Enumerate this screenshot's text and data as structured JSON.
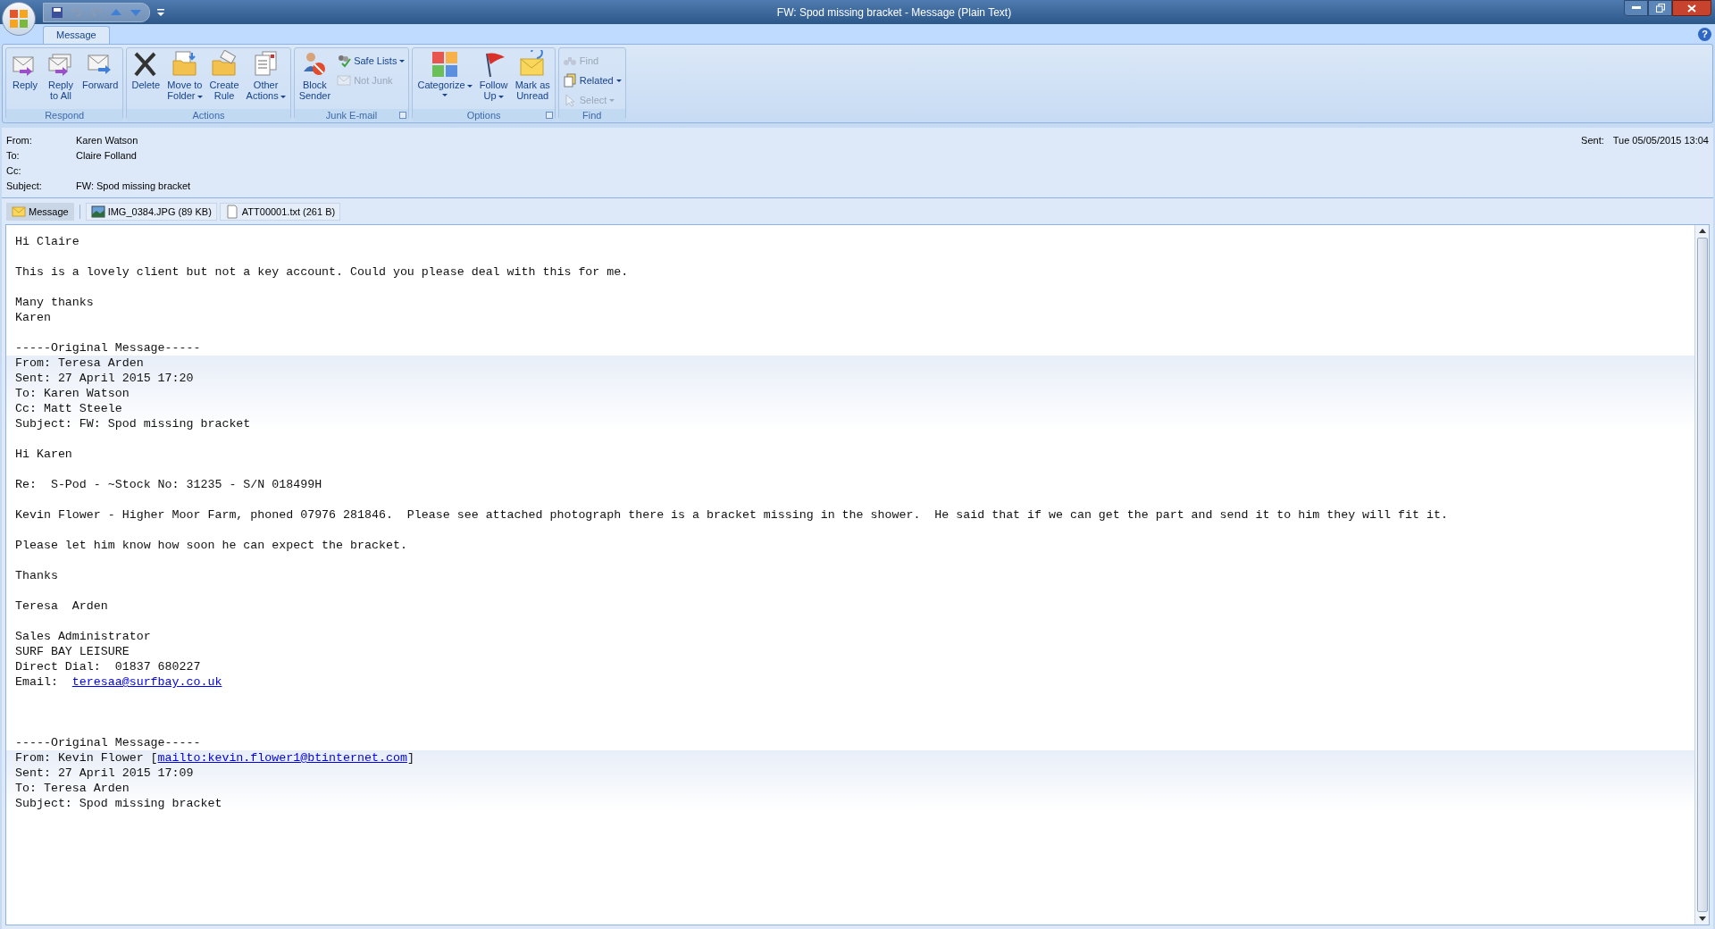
{
  "window": {
    "title": "FW: Spod missing bracket  - Message (Plain Text)"
  },
  "tabs": [
    {
      "label": "Message",
      "selected": true
    }
  ],
  "help_button": "?",
  "ribbon": [
    {
      "label": "Respond",
      "launcher": false,
      "buttons": [
        {
          "lines": [
            "Reply"
          ],
          "kind": "large",
          "dropdown": false,
          "disabled": false
        },
        {
          "lines": [
            "Reply",
            "to All"
          ],
          "kind": "large",
          "dropdown": false,
          "disabled": false
        },
        {
          "lines": [
            "Forward"
          ],
          "kind": "large",
          "dropdown": false,
          "disabled": false
        }
      ]
    },
    {
      "label": "Actions",
      "launcher": false,
      "buttons": [
        {
          "lines": [
            "Delete"
          ],
          "kind": "large",
          "dropdown": false,
          "disabled": false
        },
        {
          "lines": [
            "Move to",
            "Folder"
          ],
          "kind": "large",
          "dropdown": true,
          "disabled": false
        },
        {
          "lines": [
            "Create",
            "Rule"
          ],
          "kind": "large",
          "dropdown": false,
          "disabled": false
        },
        {
          "lines": [
            "Other",
            "Actions"
          ],
          "kind": "large",
          "dropdown": true,
          "disabled": false
        }
      ]
    },
    {
      "label": "Junk E-mail",
      "launcher": true,
      "buttons": [
        {
          "lines": [
            "Block",
            "Sender"
          ],
          "kind": "large",
          "dropdown": false,
          "disabled": false
        },
        {
          "lines": [
            "Safe Lists"
          ],
          "kind": "small",
          "dropdown": true,
          "disabled": false
        },
        {
          "lines": [
            "Not Junk"
          ],
          "kind": "small",
          "dropdown": false,
          "disabled": true
        }
      ]
    },
    {
      "label": "Options",
      "launcher": true,
      "buttons": [
        {
          "lines": [
            "Categorize"
          ],
          "kind": "large",
          "dropdown": true,
          "disabled": false
        },
        {
          "lines": [
            "Follow",
            "Up"
          ],
          "kind": "large",
          "dropdown": true,
          "disabled": false
        },
        {
          "lines": [
            "Mark as",
            "Unread"
          ],
          "kind": "large",
          "dropdown": false,
          "disabled": false
        }
      ]
    },
    {
      "label": "Find",
      "launcher": false,
      "buttons": [
        {
          "lines": [
            "Find"
          ],
          "kind": "small",
          "dropdown": false,
          "disabled": true
        },
        {
          "lines": [
            "Related"
          ],
          "kind": "small",
          "dropdown": true,
          "disabled": false
        },
        {
          "lines": [
            "Select"
          ],
          "kind": "small",
          "dropdown": true,
          "disabled": true
        }
      ]
    }
  ],
  "header": {
    "fields": [
      {
        "label": "From:",
        "value": "Karen Watson"
      },
      {
        "label": "To:",
        "value": "Claire Folland"
      },
      {
        "label": "Cc:"
      },
      {
        "label": "Subject:",
        "value": "FW: Spod missing bracket"
      }
    ],
    "sent_label": "Sent:",
    "sent_value": "Tue 05/05/2015 13:04"
  },
  "attachments": [
    {
      "label": "Message",
      "kind": "message",
      "selected": true
    },
    {
      "label": "IMG_0384.JPG (89 KB)",
      "kind": "image",
      "selected": false
    },
    {
      "label": "ATT00001.txt (261 B)",
      "kind": "text",
      "selected": false
    }
  ],
  "body": [
    {
      "kind": "paragraph",
      "lines": [
        "Hi Claire"
      ]
    },
    {
      "kind": "paragraph",
      "lines": [
        "This is a lovely client but not a key account. Could you please deal with this for me."
      ]
    },
    {
      "kind": "paragraph",
      "lines": [
        "Many thanks",
        "Karen"
      ]
    },
    {
      "kind": "paragraph",
      "lines": [
        "-----Original Message-----"
      ]
    },
    {
      "kind": "quote-header",
      "lines": [
        "From: Teresa Arden",
        "Sent: 27 April 2015 17:20",
        "To: Karen Watson",
        "Cc: Matt Steele",
        "Subject: FW: Spod missing bracket"
      ]
    },
    {
      "kind": "paragraph",
      "lines": [
        "Hi Karen"
      ]
    },
    {
      "kind": "paragraph",
      "lines": [
        "Re:  S-Pod - ~Stock No: 31235 - S/N 018499H"
      ]
    },
    {
      "kind": "paragraph",
      "lines": [
        "Kevin Flower - Higher Moor Farm, phoned 07976 281846.  Please see attached photograph there is a bracket missing in the shower.  He said that if we can get the part and send it to him they will fit it."
      ]
    },
    {
      "kind": "paragraph",
      "lines": [
        "Please let him know how soon he can expect the bracket."
      ]
    },
    {
      "kind": "paragraph",
      "lines": [
        "Thanks"
      ]
    },
    {
      "kind": "paragraph",
      "lines": [
        "Teresa  Arden"
      ]
    },
    {
      "kind": "paragraph",
      "lines": [
        "Sales Administrator",
        "SURF BAY LEISURE",
        "Direct Dial:  01837 680227",
        [
          {
            "text": "Email:  ",
            "link": false
          },
          {
            "text": "teresaa@surfbay.co.uk",
            "link": true
          }
        ]
      ]
    },
    {
      "kind": "break"
    },
    {
      "kind": "paragraph",
      "lines": [
        "-----Original Message-----"
      ]
    },
    {
      "kind": "quote-header",
      "lines": [
        [
          {
            "text": "From: Kevin Flower [",
            "link": false
          },
          {
            "text": "mailto:kevin.flower1@btinternet.com",
            "link": true
          },
          {
            "text": "]",
            "link": false
          }
        ],
        "Sent: 27 April 2015 17:09",
        "To: Teresa Arden",
        "Subject: Spod missing bracket"
      ]
    }
  ]
}
